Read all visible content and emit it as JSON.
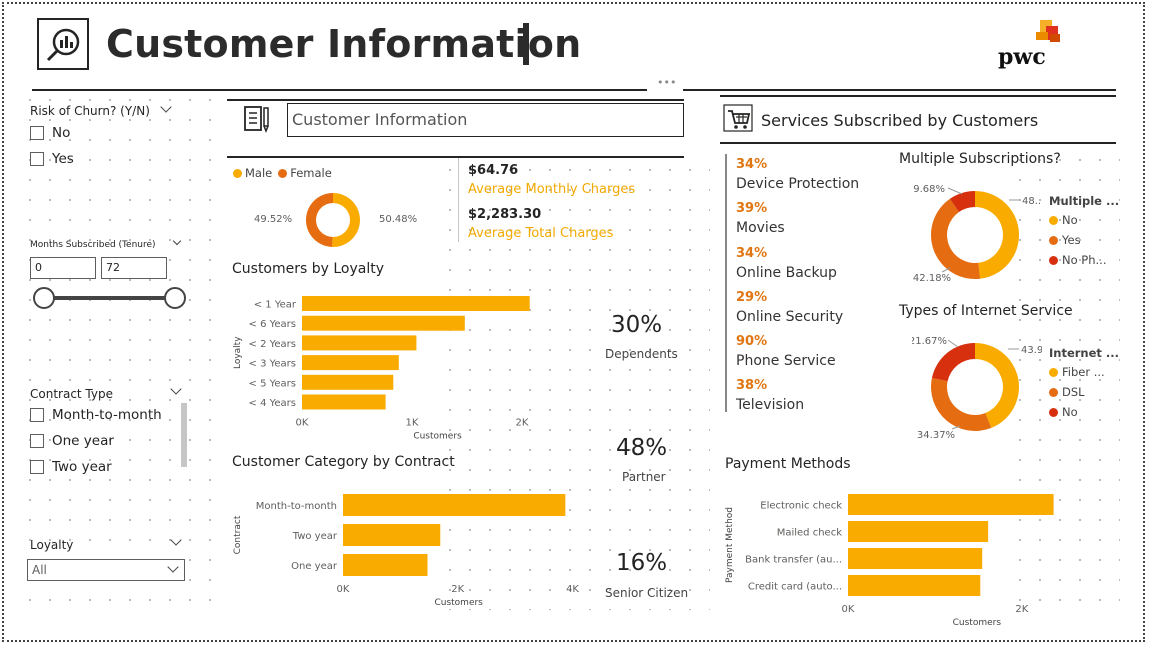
{
  "header": {
    "title": "Customer Information",
    "logo_text": "pwc",
    "more_options": "•••"
  },
  "colors": {
    "accent": "#f9ab00",
    "dark_orange": "#e66c11",
    "red": "#d6300f"
  },
  "filters": {
    "churn": {
      "title": "Risk of Churn? (Y/N)",
      "options": [
        "No",
        "Yes"
      ]
    },
    "tenure": {
      "title": "Months Subscribed (Tenure)",
      "min": "0",
      "max": "72"
    },
    "contract": {
      "title": "Contract Type",
      "options": [
        "Month-to-month",
        "One year",
        "Two year"
      ]
    },
    "loyalty": {
      "title": "Loyalty",
      "value": "All"
    }
  },
  "customer_section": {
    "title": "Customer Information",
    "gender_legend": [
      "Male",
      "Female"
    ],
    "gender_labels": {
      "left": "49.52%",
      "right": "50.48%"
    },
    "avg_monthly_value": "$64.76",
    "avg_monthly_label": "Average Monthly Charges",
    "avg_total_value": "$2,283.30",
    "avg_total_label": "Average Total Charges"
  },
  "kpis": [
    {
      "value": "30%",
      "label": "Dependents"
    },
    {
      "value": "48%",
      "label": "Partner"
    },
    {
      "value": "16%",
      "label": "Senior Citizen"
    }
  ],
  "services_section": {
    "title": "Services Subscribed by Customers",
    "items": [
      {
        "pct": "34%",
        "name": "Device Protection"
      },
      {
        "pct": "39%",
        "name": "Movies"
      },
      {
        "pct": "34%",
        "name": "Online Backup"
      },
      {
        "pct": "29%",
        "name": "Online Security"
      },
      {
        "pct": "90%",
        "name": "Phone Service"
      },
      {
        "pct": "38%",
        "name": "Television"
      }
    ]
  },
  "chart_data": [
    {
      "type": "bar",
      "title": "Customers by Loyalty",
      "orientation": "horizontal",
      "categories": [
        "< 1 Year",
        "< 6 Years",
        "< 2 Years",
        "< 3 Years",
        "< 5 Years",
        "< 4 Years"
      ],
      "values": [
        2070,
        1480,
        1040,
        880,
        830,
        760
      ],
      "xlabel": "Customers",
      "ylabel": "Loyalty",
      "xticks": [
        "0K",
        "1K",
        "2K"
      ],
      "xlim": [
        0,
        2200
      ]
    },
    {
      "type": "bar",
      "title": "Customer Category by Contract",
      "orientation": "horizontal",
      "categories": [
        "Month-to-month",
        "Two year",
        "One year"
      ],
      "values": [
        3875,
        1695,
        1473
      ],
      "xlabel": "Customers",
      "ylabel": "Contract",
      "xticks": [
        "0K",
        "2K",
        "4K"
      ],
      "xlim": [
        0,
        4200
      ]
    },
    {
      "type": "bar",
      "title": "Payment Methods",
      "orientation": "horizontal",
      "categories": [
        "Electronic check",
        "Mailed check",
        "Bank transfer (au...",
        "Credit card (auto..."
      ],
      "values": [
        2365,
        1612,
        1544,
        1522
      ],
      "xlabel": "Customers",
      "ylabel": "Payment Method",
      "xticks": [
        "0K",
        "2K"
      ],
      "xlim": [
        0,
        2600
      ]
    },
    {
      "type": "pie",
      "donut": true,
      "title": "",
      "series_labels": [
        "Male",
        "Female"
      ],
      "values": [
        50.48,
        49.52
      ],
      "labels": [
        "50.48%",
        "49.52%"
      ]
    },
    {
      "type": "pie",
      "donut": true,
      "title": "Multiple Subscriptions?",
      "legend_title": "Multiple ...",
      "series_labels": [
        "No",
        "Yes",
        "No Ph..."
      ],
      "values": [
        48.14,
        42.18,
        9.68
      ],
      "labels": [
        "48....",
        "42.18%",
        "9.68%"
      ]
    },
    {
      "type": "pie",
      "donut": true,
      "title": "Types of Internet Service",
      "legend_title": "Internet ...",
      "series_labels": [
        "Fiber ...",
        "DSL",
        "No"
      ],
      "values": [
        43.96,
        34.37,
        21.67
      ],
      "labels": [
        "43.9...",
        "34.37%",
        "21.67%"
      ]
    }
  ]
}
